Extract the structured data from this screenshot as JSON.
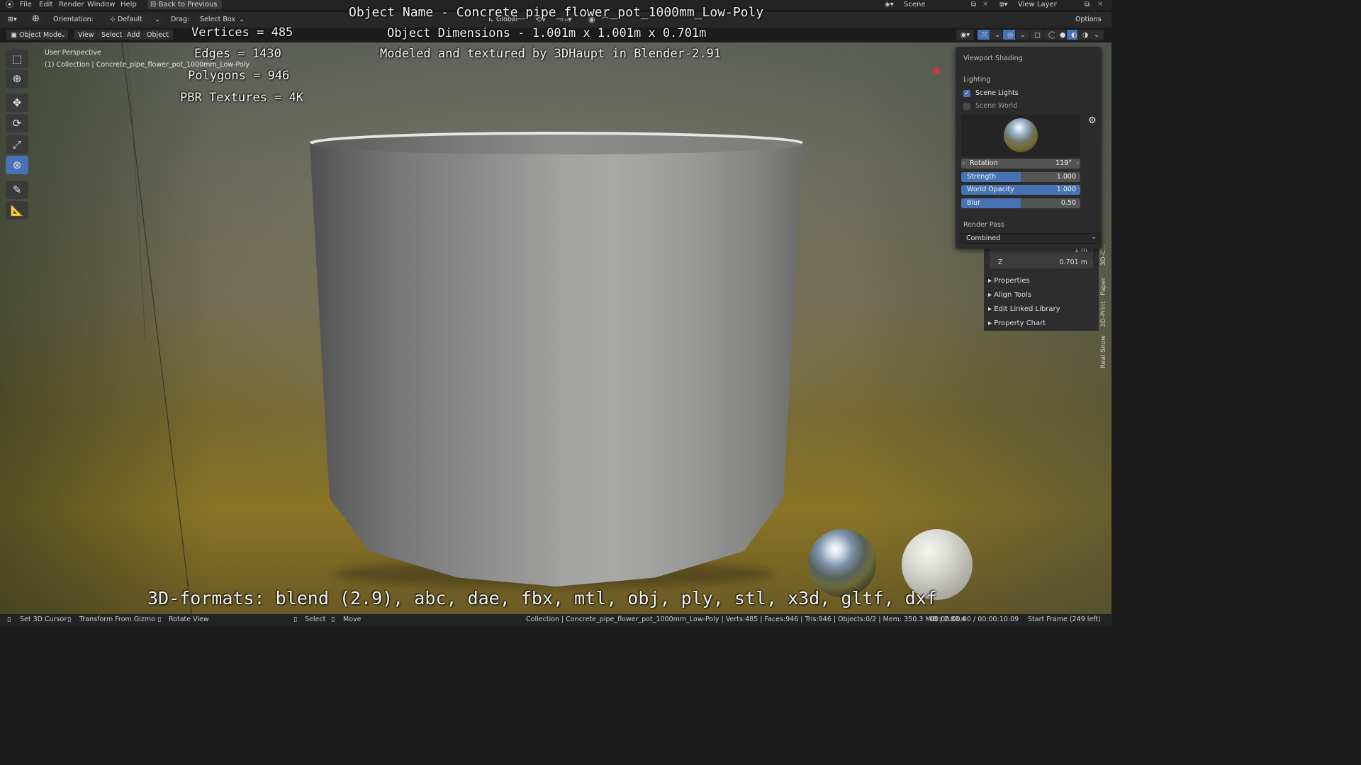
{
  "menubar": {
    "items": [
      "File",
      "Edit",
      "Render",
      "Window",
      "Help"
    ],
    "back_to_previous": "Back to Previous",
    "scene": "Scene",
    "view_layer": "View Layer"
  },
  "tool_header": {
    "orientation_label": "Orientation:",
    "orientation_value": "Default",
    "drag_label": "Drag:",
    "drag_value": "Select Box",
    "transform_space": "Global",
    "options": "Options"
  },
  "viewport_header": {
    "mode": "Object Mode",
    "menus": [
      "View",
      "Select",
      "Add",
      "Object"
    ]
  },
  "viewport": {
    "perspective": "User Perspective",
    "collection_label": "(1) Collection | Concrete_pipe_flower_pot_1000mm_Low-Poly",
    "stats": {
      "vertices": "Vertices = 485",
      "edges": "Edges = 1430",
      "polygons": "Polygons = 946",
      "textures": "PBR Textures = 4K"
    },
    "info": {
      "object_name": "Object Name - Concrete_pipe_flower_pot_1000mm_Low-Poly",
      "dimensions": "Object Dimensions -  1.001m x 1.001m x 0.701m",
      "credit": "Modeled and textured by 3DHaupt in Blender-2.91"
    },
    "formats": "3D-formats: blend (2.9), abc, dae, fbx, mtl, obj, ply, stl, x3d, gltf, dxf"
  },
  "shading_popover": {
    "title": "Viewport Shading",
    "lighting_label": "Lighting",
    "scene_lights": "Scene Lights",
    "scene_lights_checked": true,
    "scene_world": "Scene World",
    "scene_world_checked": false,
    "sliders": [
      {
        "label": "Rotation",
        "value": "119°",
        "fill": 0
      },
      {
        "label": "Strength",
        "value": "1.000",
        "fill": 0.5
      },
      {
        "label": "World Opacity",
        "value": "1.000",
        "fill": 1.0
      },
      {
        "label": "Blur",
        "value": "0.50",
        "fill": 0.5
      }
    ],
    "render_pass_label": "Render Pass",
    "render_pass_value": "Combined"
  },
  "n_panel": {
    "partial_y_value": "1 m",
    "z_label": "Z",
    "z_value": "0.701 m",
    "sections": [
      "Properties",
      "Align Tools",
      "Edit Linked Library",
      "Property Chart"
    ]
  },
  "side_tabs": [
    "3D-C...",
    "Paper",
    "3D-Print",
    "Real Snow"
  ],
  "statusbar": {
    "set_cursor": "Set 3D Cursor",
    "transform_gizmo": "Transform From Gizmo",
    "rotate_view": "Rotate View",
    "select": "Select",
    "move": "Move",
    "scene_info": "Collection | Concrete_pipe_flower_pot_1000mm_Low-Poly | Verts:485 | Faces:946 | Tris:946 | Objects:0/2 | Mem: 350.3 MiB | 2.83.4",
    "timecode": "00:00:00:00 / 00:00:10:09",
    "start_frame": "Start Frame (249 left)"
  },
  "colors": {
    "accent": "#4772b3",
    "ui_dark": "#232323",
    "panel": "#2b2b2b"
  }
}
